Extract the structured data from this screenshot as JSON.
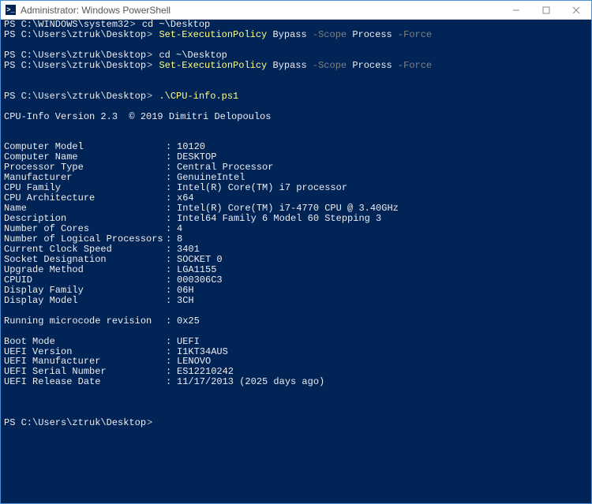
{
  "window": {
    "title": "Administrator: Windows PowerShell"
  },
  "lines": [
    {
      "type": "prompt",
      "path": "PS C:\\WINDOWS\\system32",
      "tokens": [
        {
          "t": "w",
          "v": "cd ~\\Desktop"
        }
      ]
    },
    {
      "type": "prompt",
      "path": "PS C:\\Users\\ztruk\\Desktop",
      "tokens": [
        {
          "t": "y",
          "v": "Set-ExecutionPolicy "
        },
        {
          "t": "w",
          "v": "Bypass "
        },
        {
          "t": "g",
          "v": "-Scope "
        },
        {
          "t": "w",
          "v": "Process "
        },
        {
          "t": "g",
          "v": "-Force"
        }
      ]
    },
    {
      "type": "blank"
    },
    {
      "type": "prompt",
      "path": "PS C:\\Users\\ztruk\\Desktop",
      "tokens": [
        {
          "t": "w",
          "v": "cd ~\\Desktop"
        }
      ]
    },
    {
      "type": "prompt",
      "path": "PS C:\\Users\\ztruk\\Desktop",
      "tokens": [
        {
          "t": "y",
          "v": "Set-ExecutionPolicy "
        },
        {
          "t": "w",
          "v": "Bypass "
        },
        {
          "t": "g",
          "v": "-Scope "
        },
        {
          "t": "w",
          "v": "Process "
        },
        {
          "t": "g",
          "v": "-Force"
        }
      ]
    },
    {
      "type": "blank"
    },
    {
      "type": "blank"
    },
    {
      "type": "prompt",
      "path": "PS C:\\Users\\ztruk\\Desktop",
      "tokens": [
        {
          "t": "y",
          "v": ".\\CPU-info.ps1"
        }
      ]
    },
    {
      "type": "blank"
    },
    {
      "type": "text",
      "v": "CPU-Info Version 2.3  © 2019 Dimitri Delopoulos"
    },
    {
      "type": "blank"
    },
    {
      "type": "blank"
    },
    {
      "type": "kv",
      "k": "Computer Model",
      "v": "10120"
    },
    {
      "type": "kv",
      "k": "Computer Name",
      "v": "DESKTOP"
    },
    {
      "type": "kv",
      "k": "Processor Type",
      "v": "Central Processor"
    },
    {
      "type": "kv",
      "k": "Manufacturer",
      "v": "GenuineIntel"
    },
    {
      "type": "kv",
      "k": "CPU Family",
      "v": "Intel(R) Core(TM) i7 processor"
    },
    {
      "type": "kv",
      "k": "CPU Architecture",
      "v": "x64"
    },
    {
      "type": "kv",
      "k": "Name",
      "v": "Intel(R) Core(TM) i7-4770 CPU @ 3.40GHz"
    },
    {
      "type": "kv",
      "k": "Description",
      "v": "Intel64 Family 6 Model 60 Stepping 3"
    },
    {
      "type": "kv",
      "k": "Number of Cores",
      "v": "4"
    },
    {
      "type": "kv",
      "k": "Number of Logical Processors",
      "v": "8"
    },
    {
      "type": "kv",
      "k": "Current Clock Speed",
      "v": "3401"
    },
    {
      "type": "kv",
      "k": "Socket Designation",
      "v": "SOCKET 0"
    },
    {
      "type": "kv",
      "k": "Upgrade Method",
      "v": "LGA1155"
    },
    {
      "type": "kv",
      "k": "CPUID",
      "v": "000306C3"
    },
    {
      "type": "kv",
      "k": "Display Family",
      "v": "06H"
    },
    {
      "type": "kv",
      "k": "Display Model",
      "v": "3CH"
    },
    {
      "type": "blank"
    },
    {
      "type": "kv",
      "k": "Running microcode revision",
      "v": "0x25"
    },
    {
      "type": "blank"
    },
    {
      "type": "kv",
      "k": "Boot Mode",
      "v": "UEFI"
    },
    {
      "type": "kv",
      "k": "UEFI Version",
      "v": "I1KT34AUS"
    },
    {
      "type": "kv",
      "k": "UEFI Manufacturer",
      "v": "LENOVO"
    },
    {
      "type": "kv",
      "k": "UEFI Serial Number",
      "v": "ES12210242"
    },
    {
      "type": "kv",
      "k": "UEFI Release Date",
      "v": "11/17/2013 (2025 days ago)"
    },
    {
      "type": "blank"
    },
    {
      "type": "blank"
    },
    {
      "type": "blank"
    },
    {
      "type": "prompt",
      "path": "PS C:\\Users\\ztruk\\Desktop",
      "tokens": []
    }
  ]
}
